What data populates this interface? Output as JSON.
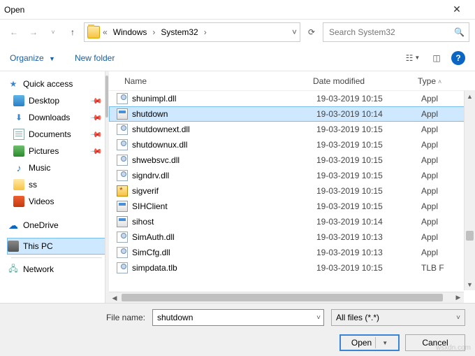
{
  "window": {
    "title": "Open"
  },
  "breadcrumb": {
    "items": [
      "Windows",
      "System32"
    ]
  },
  "search": {
    "placeholder": "Search System32"
  },
  "toolbar": {
    "organize": "Organize",
    "newfolder": "New folder"
  },
  "sidebar": {
    "quick": {
      "label": "Quick access"
    },
    "items": [
      {
        "label": "Desktop",
        "pinned": true
      },
      {
        "label": "Downloads",
        "pinned": true
      },
      {
        "label": "Documents",
        "pinned": true
      },
      {
        "label": "Pictures",
        "pinned": true
      },
      {
        "label": "Music"
      },
      {
        "label": "ss"
      },
      {
        "label": "Videos"
      }
    ],
    "onedrive": {
      "label": "OneDrive"
    },
    "thispc": {
      "label": "This PC"
    },
    "network": {
      "label": "Network"
    }
  },
  "columns": {
    "name": "Name",
    "date": "Date modified",
    "type": "Type"
  },
  "files": [
    {
      "name": "shunimpl.dll",
      "date": "19-03-2019 10:15",
      "type": "Appl",
      "kind": "dll"
    },
    {
      "name": "shutdown",
      "date": "19-03-2019 10:14",
      "type": "Appl",
      "kind": "app",
      "selected": true
    },
    {
      "name": "shutdownext.dll",
      "date": "19-03-2019 10:15",
      "type": "Appl",
      "kind": "dll"
    },
    {
      "name": "shutdownux.dll",
      "date": "19-03-2019 10:15",
      "type": "Appl",
      "kind": "dll"
    },
    {
      "name": "shwebsvc.dll",
      "date": "19-03-2019 10:15",
      "type": "Appl",
      "kind": "dll"
    },
    {
      "name": "signdrv.dll",
      "date": "19-03-2019 10:15",
      "type": "Appl",
      "kind": "dll"
    },
    {
      "name": "sigverif",
      "date": "19-03-2019 10:15",
      "type": "Appl",
      "kind": "sigverif"
    },
    {
      "name": "SIHClient",
      "date": "19-03-2019 10:15",
      "type": "Appl",
      "kind": "app"
    },
    {
      "name": "sihost",
      "date": "19-03-2019 10:14",
      "type": "Appl",
      "kind": "app"
    },
    {
      "name": "SimAuth.dll",
      "date": "19-03-2019 10:13",
      "type": "Appl",
      "kind": "dll"
    },
    {
      "name": "SimCfg.dll",
      "date": "19-03-2019 10:13",
      "type": "Appl",
      "kind": "dll"
    },
    {
      "name": "simpdata.tlb",
      "date": "19-03-2019 10:15",
      "type": "TLB F",
      "kind": "dll"
    }
  ],
  "footer": {
    "filename_label": "File name:",
    "filename_value": "shutdown",
    "filter": "All files (*.*)",
    "open": "Open",
    "cancel": "Cancel"
  },
  "watermark": "wsxdn.com"
}
